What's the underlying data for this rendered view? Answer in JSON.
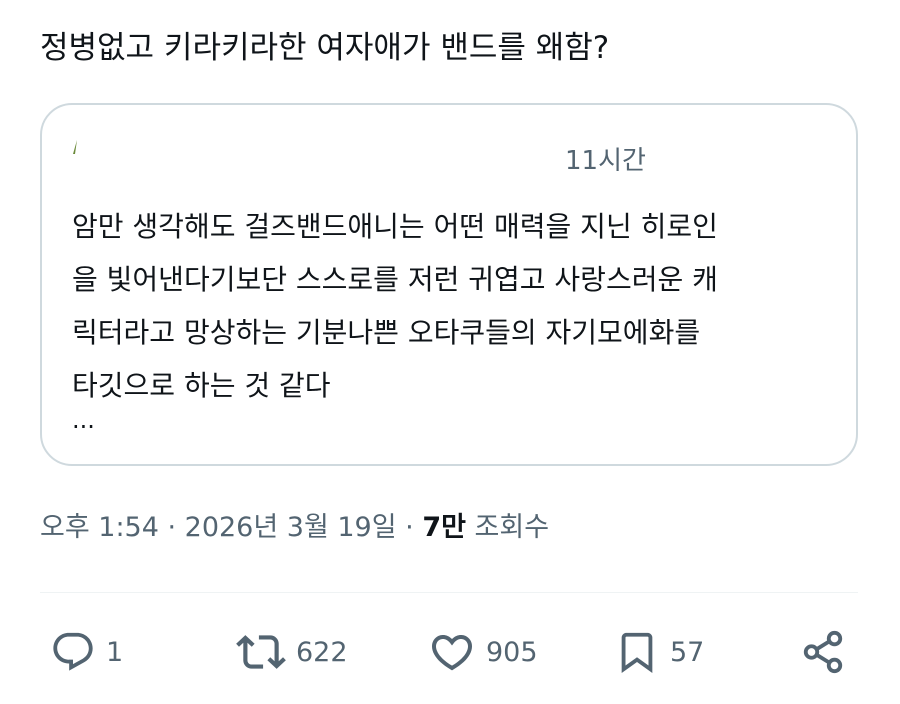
{
  "tweet": {
    "text": "정병없고 키라키라한 여자애가 밴드를 왜함?"
  },
  "quote": {
    "time": "11시간",
    "lines": [
      "암만 생각해도 걸즈밴드애니는 어떤 매력을 지닌 히로인",
      "을 빛어낸다기보단 스스로를 저런 귀엽고 사랑스러운 캐",
      "릭터라고 망상하는 기분나쁜 오타쿠들의 자기모에화를",
      "타깃으로 하는 것 같다"
    ],
    "truncation": "..."
  },
  "meta": {
    "timestamp": "오후 1:54 · 2026년 3월 19일 · ",
    "views_count": "7만",
    "views_label": " 조회수"
  },
  "actions": {
    "reply": {
      "icon": "reply-icon",
      "count": "1"
    },
    "retweet": {
      "icon": "retweet-icon",
      "count": "622"
    },
    "like": {
      "icon": "heart-icon",
      "count": "905"
    },
    "bookmark": {
      "icon": "bookmark-icon",
      "count": "57"
    },
    "share": {
      "icon": "share-icon"
    }
  },
  "colors": {
    "text_primary": "#0f1419",
    "text_secondary": "#536471",
    "border": "#cfd9de"
  }
}
